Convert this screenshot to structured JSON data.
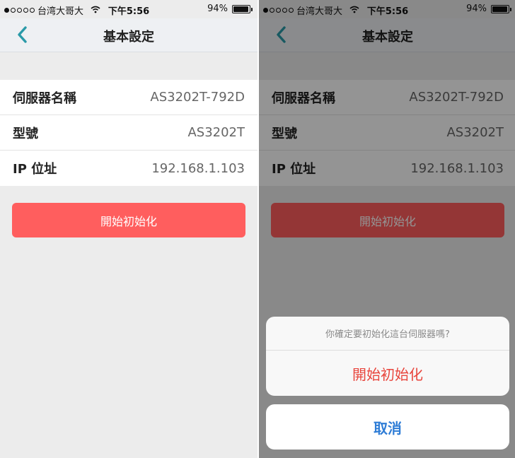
{
  "status_bar": {
    "carrier": "台湾大哥大",
    "time": "下午5:56",
    "battery": "94%",
    "battery_level": 0.94
  },
  "nav": {
    "title": "基本設定"
  },
  "info": [
    {
      "label": "伺服器名稱",
      "value": "AS3202T-792D"
    },
    {
      "label": "型號",
      "value": "AS3202T"
    },
    {
      "label": "IP 位址",
      "value": "192.168.1.103"
    }
  ],
  "init_button_label": "開始初始化",
  "action_sheet": {
    "message": "你確定要初始化這台伺服器嗎?",
    "confirm_label": "開始初始化",
    "cancel_label": "取消"
  },
  "colors": {
    "accent": "#2a9aa8",
    "init_button": "#ff5e5e",
    "destructive_text": "#e8453c",
    "cancel_text": "#2f7dd6"
  }
}
